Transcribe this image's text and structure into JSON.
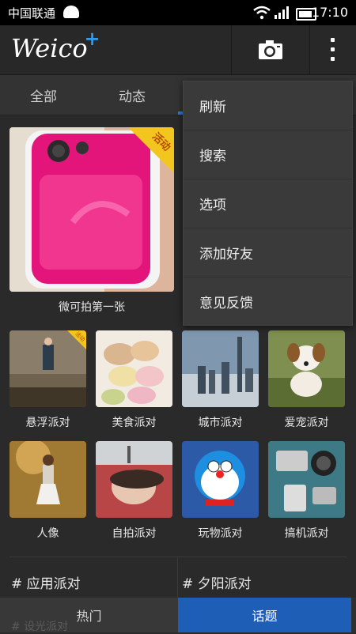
{
  "statusbar": {
    "carrier": "中国联通",
    "time": "17:10"
  },
  "app": {
    "logo_text": "Weico",
    "logo_plus": "+"
  },
  "tabs": [
    {
      "label": "全部"
    },
    {
      "label": "动态"
    }
  ],
  "menu": {
    "items": [
      {
        "label": "刷新"
      },
      {
        "label": "搜索"
      },
      {
        "label": "选项"
      },
      {
        "label": "添加好友"
      },
      {
        "label": "意见反馈"
      }
    ]
  },
  "featured": {
    "caption": "微可拍第一张",
    "badge": "活动"
  },
  "grid_row1": [
    {
      "label": "悬浮派对",
      "badge": "活动"
    },
    {
      "label": "美食派对"
    },
    {
      "label": "城市派对"
    },
    {
      "label": "爱宠派对"
    }
  ],
  "grid_row2": [
    {
      "label": "人像"
    },
    {
      "label": "自拍派对"
    },
    {
      "label": "玩物派对"
    },
    {
      "label": "搞机派对"
    }
  ],
  "topics": [
    {
      "label": "# 应用派对"
    },
    {
      "label": "# 夕阳派对"
    }
  ],
  "bottom_tabs": {
    "hot": "热门",
    "topic": "话题",
    "ghost_text": "# 设光派对"
  },
  "colors": {
    "accent": "#1f5eb7",
    "ribbon": "#f2c61f",
    "logo_plus": "#2a9ef5"
  }
}
